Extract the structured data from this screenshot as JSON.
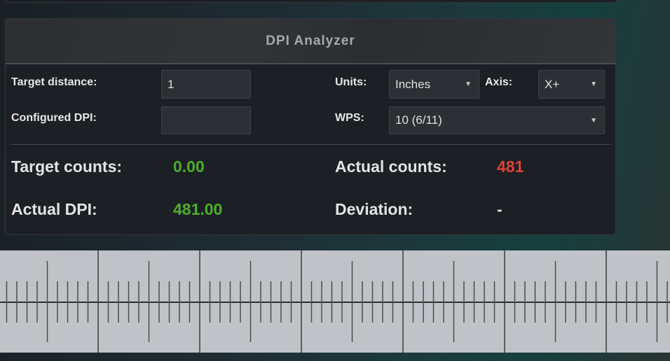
{
  "panel": {
    "title": "DPI Analyzer"
  },
  "form": {
    "target_distance_label": "Target distance:",
    "target_distance_value": "1",
    "configured_dpi_label": "Configured DPI:",
    "configured_dpi_value": "",
    "units_label": "Units:",
    "units_value": "Inches",
    "axis_label": "Axis:",
    "axis_value": "X+",
    "wps_label": "WPS:",
    "wps_value": "10 (6/11)"
  },
  "results": {
    "target_counts_label": "Target counts:",
    "target_counts_value": "0.00",
    "actual_counts_label": "Actual counts:",
    "actual_counts_value": "481",
    "actual_dpi_label": "Actual DPI:",
    "actual_dpi_value": "481.00",
    "deviation_label": "Deviation:",
    "deviation_value": "-"
  },
  "colors": {
    "good": "#4caf2a",
    "bad": "#d9453a"
  },
  "ruler": {
    "subdivisions_per_major": 10
  }
}
